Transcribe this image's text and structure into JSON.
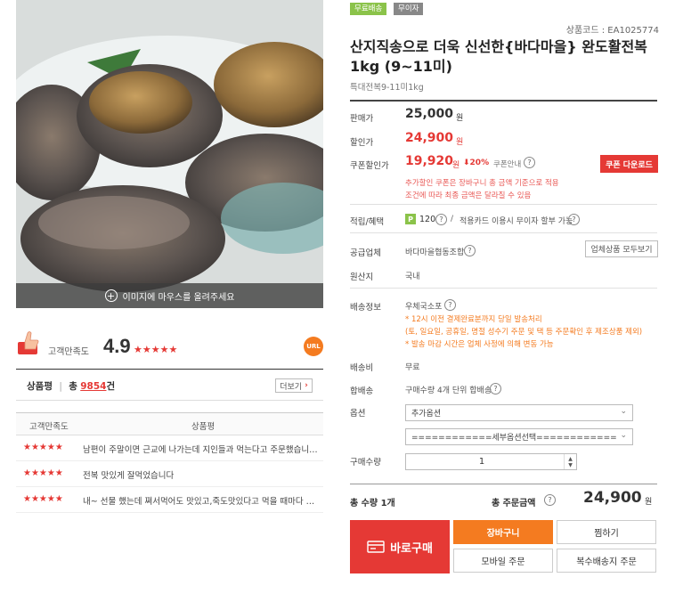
{
  "image_overlay": {
    "text": "이미지에 마우스를 올려주세요",
    "icon": "plus-circle-icon"
  },
  "satisfaction": {
    "label": "고객만족도",
    "score": "4.9",
    "stars": "★★★★★",
    "badge": "URL"
  },
  "review_summary": {
    "label": "상품평",
    "separator": "|",
    "total_prefix": "총",
    "count": "9854",
    "unit": "건",
    "more": "더보기"
  },
  "review_table": {
    "headers": [
      "고객만족도",
      "상품평"
    ],
    "rows": [
      {
        "stars": "★★★★★",
        "text": "남편이 주말이면 근교에 나가는데 지인들과 먹는다고 주문했습니다. ..."
      },
      {
        "stars": "★★★★★",
        "text": "전복 맛있게 잘먹었습니다"
      },
      {
        "stars": "★★★★★",
        "text": "내~ 선물 했는데 쪄서먹어도 맛있고,죽도맛있다고 먹을 때마다 전화..."
      }
    ]
  },
  "tags": [
    "무료배송",
    "무이자"
  ],
  "product": {
    "code": "상품코드 : EA1025774",
    "title": "산지직송으로 더욱 신선한{바다마을} 완도활전복 1kg (9~11미)",
    "subtitle": "특대전복9-11미1kg"
  },
  "pricing": {
    "list_label": "판매가",
    "list_price": "25,000",
    "won": "원",
    "sale_label": "할인가",
    "sale_price": "24,900",
    "coupon_label": "쿠폰할인가",
    "coupon_price": "19,920",
    "coupon_pct": "⬇20%",
    "coupon_info": "쿠폰안내",
    "coupon_button": "쿠폰 다운로드",
    "coupon_note_1": "추가할인 쿠폰은 장바구니 총 금액 기준으로 적용",
    "coupon_note_2": "조건에 따라 최종 금액은 달라질 수 있음"
  },
  "benefits": {
    "label": "적립/혜택",
    "point_icon": "P",
    "points": "120",
    "card_text": "적용카드 이용시 무이자 할부 가능"
  },
  "supplier": {
    "label": "공급업체",
    "name": "바다마을협동조합",
    "button": "업체상품 모두보기"
  },
  "origin": {
    "label": "원산지",
    "value": "국내"
  },
  "shipping_info": {
    "label": "배송정보",
    "carrier": "우체국소포",
    "note_1": "* 12시 이전 결제완료분까지 당일 발송처리",
    "note_2": "(토, 일요일, 공휴일, 명절 성수기 주문 및 택 등 주문확인 후 제조상품 제외)",
    "note_3": "* 발송 마감 시간은 업체 사정에 의해 변동 가능"
  },
  "shipping_fee": {
    "label": "배송비",
    "value": "무료"
  },
  "bundle": {
    "label": "합배송",
    "value": "구매수량 4개 단위 합배송"
  },
  "options": {
    "label": "옵션",
    "select_1": "추가옵션",
    "select_2": "============세부옵션선택============"
  },
  "quantity": {
    "label": "구매수량",
    "value": "1"
  },
  "totals": {
    "count_label": "총 수량 1개",
    "amount_label": "총 주문금액",
    "amount": "24,900",
    "won": "원"
  },
  "actions": {
    "buy_now": "바로구매",
    "cart": "장바구니",
    "wish": "찜하기",
    "mobile": "모바일 주문",
    "multi": "복수배송지 주문"
  },
  "colors": {
    "accent_red": "#e53935",
    "accent_orange": "#f47b20",
    "free_tag": "#8bc34a"
  }
}
